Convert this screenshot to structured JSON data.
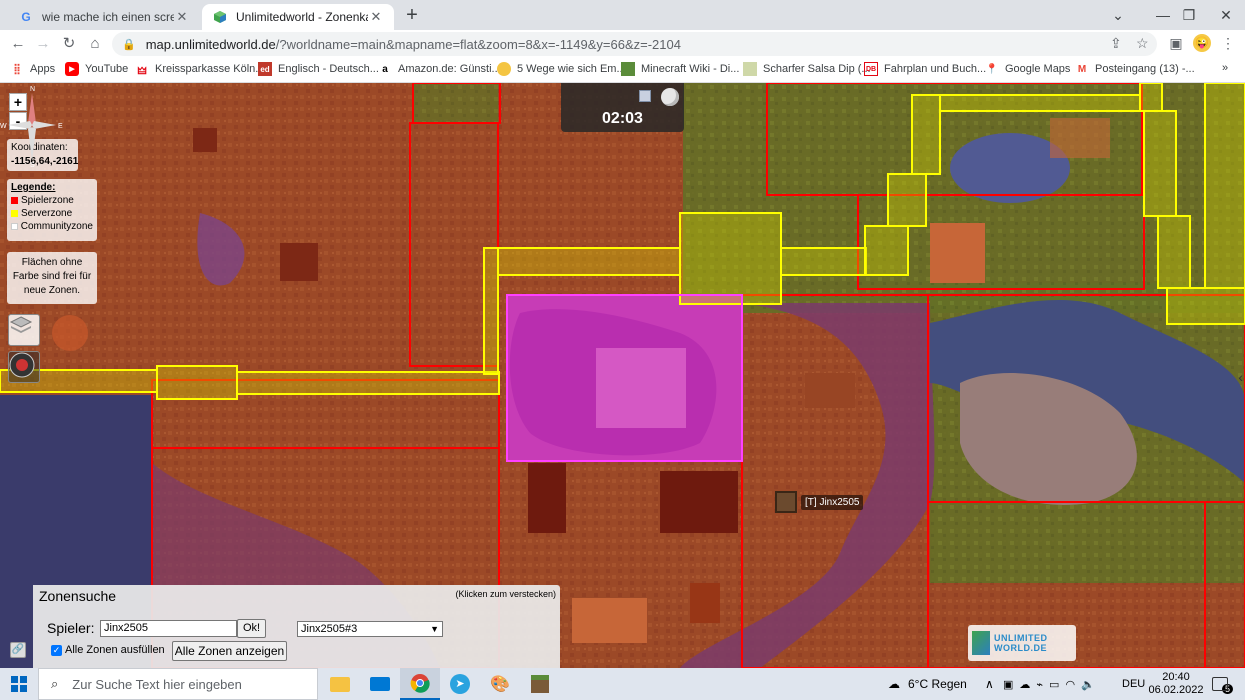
{
  "browser": {
    "tabs": [
      {
        "title": "wie mache ich einen screenshot a",
        "active": false,
        "favicon": "google-icon"
      },
      {
        "title": "Unlimitedworld - Zonenkarte",
        "active": true,
        "favicon": "unlimitedworld-icon"
      }
    ],
    "url_host": "map.unlimitedworld.de",
    "url_rest": "/?worldname=main&mapname=flat&zoom=8&x=-1149&y=66&z=-2104",
    "bookmarks": [
      {
        "label": "Apps",
        "icon": "apps-icon"
      },
      {
        "label": "YouTube",
        "icon": "youtube-icon"
      },
      {
        "label": "Kreissparkasse Köln...",
        "icon": "sparkasse-icon"
      },
      {
        "label": "Englisch - Deutsch...",
        "icon": "dict-icon"
      },
      {
        "label": "Amazon.de: Günsti...",
        "icon": "amazon-icon"
      },
      {
        "label": "5 Wege wie sich Em...",
        "icon": "web-icon"
      },
      {
        "label": "Minecraft Wiki - Di...",
        "icon": "minecraft-icon"
      },
      {
        "label": "Scharfer Salsa Dip (...",
        "icon": "recipe-icon"
      },
      {
        "label": "Fahrplan und Buch...",
        "icon": "db-icon"
      },
      {
        "label": "Google Maps",
        "icon": "maps-icon"
      },
      {
        "label": "Posteingang (13) -...",
        "icon": "gmail-icon"
      }
    ]
  },
  "map": {
    "coords_label": "Koordinaten:",
    "coords_value": "-1156,64,-2161",
    "legend_title": "Legende:",
    "legend": [
      {
        "label": "Spielerzone",
        "color": "#ff0000"
      },
      {
        "label": "Serverzone",
        "color": "#ffff00"
      },
      {
        "label": "Communityzone",
        "color": "#ffffff"
      }
    ],
    "free_note": "Flächen ohne Farbe sind frei für neue Zonen.",
    "clock": "02:03",
    "player_name": "[T] Jinx2505",
    "zoom_in": "+",
    "zoom_out": "-"
  },
  "zonensuche": {
    "title": "Zonensuche",
    "hint": "(Klicken zum verstecken)",
    "player_label": "Spieler:",
    "player_value": "Jinx2505",
    "ok_label": "Ok!",
    "select_value": "Jinx2505#3",
    "checkbox_label": "Alle Zonen ausfüllen",
    "show_all_label": "Alle Zonen anzeigen"
  },
  "logo_text": "UNLIMITED WORLD.DE",
  "taskbar": {
    "search_placeholder": "Zur Suche Text hier eingeben",
    "weather": "6°C  Regen",
    "lang": "DEU",
    "time": "20:40",
    "date": "06.02.2022",
    "notifications": "5"
  }
}
